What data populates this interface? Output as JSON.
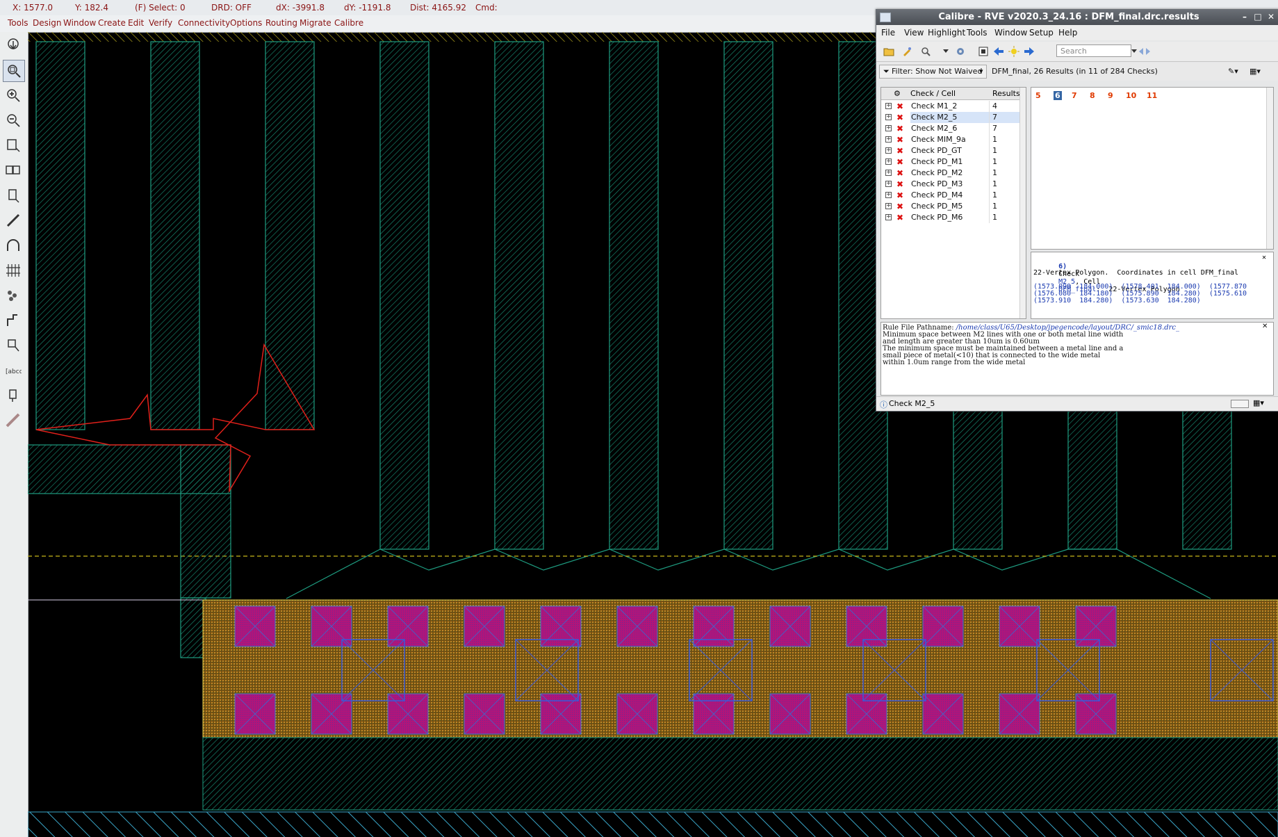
{
  "status": {
    "x": "X: 1577.0",
    "y": "Y: 182.4",
    "select": "(F) Select: 0",
    "drd": "DRD: OFF",
    "dx": "dX: -3991.8",
    "dy": "dY: -1191.8",
    "dist": "Dist: 4165.92",
    "cmd": "Cmd:"
  },
  "main_menu": [
    "Tools",
    "Design",
    "Window",
    "Create",
    "Edit",
    "Verify",
    "Connectivity",
    "Options",
    "Routing",
    "Migrate",
    "Calibre"
  ],
  "left_toolbar": [
    "select-tool-icon",
    "zoom-fit-icon",
    "zoom-in-icon",
    "zoom-out-icon",
    "rectangle-tool-icon",
    "polygon-tool-icon",
    "path-tool-icon",
    "ruler-tool-icon",
    "arc-tool-icon",
    "array-tool-icon",
    "via-tool-icon",
    "route-tool-icon",
    "corner-tool-icon",
    "label-tool-icon",
    "pin-tool-icon",
    "measure-tool-icon"
  ],
  "rve": {
    "title": "Calibre - RVE v2020.3_24.16 : DFM_final.drc.results",
    "menu": [
      "File",
      "View",
      "Highlight",
      "Tools",
      "Window",
      "Setup",
      "Help"
    ],
    "search_placeholder": "Search",
    "filter_label": "Filter: Show Not Waived",
    "summary": "DFM_final, 26 Results (in 11 of 284 Checks)",
    "checks_header": {
      "name": "Check / Cell",
      "count": "Results"
    },
    "checks": [
      {
        "name": "Check M1_2",
        "count": "4"
      },
      {
        "name": "Check M2_5",
        "count": "7",
        "selected": true
      },
      {
        "name": "Check M2_6",
        "count": "7"
      },
      {
        "name": "Check MIM_9a",
        "count": "1"
      },
      {
        "name": "Check PD_GT",
        "count": "1"
      },
      {
        "name": "Check PD_M1",
        "count": "1"
      },
      {
        "name": "Check PD_M2",
        "count": "1"
      },
      {
        "name": "Check PD_M3",
        "count": "1"
      },
      {
        "name": "Check PD_M4",
        "count": "1"
      },
      {
        "name": "Check PD_M5",
        "count": "1"
      },
      {
        "name": "Check PD_M6",
        "count": "1"
      }
    ],
    "result_numbers": [
      "5",
      "6",
      "7",
      "8",
      "9",
      "10",
      "11"
    ],
    "selected_result": "6",
    "detail": {
      "header_prefix": "6)",
      "header_check": "Check",
      "check_name": "M2_5",
      "cell_label": ", Cell",
      "cell_name": "DFM_final",
      "header_suffix": ":  22-Vertex Polygon",
      "subtitle": "22-Vertex Polygon.  Coordinates in cell DFM_final",
      "coords": [
        "(1573.099  184.000)  (1578.401  184.000)  (1577.870",
        "(1576.080  184.180)  (1575.890  184.280)  (1575.610",
        "(1573.910  184.280)  (1573.630  184.280)"
      ]
    },
    "rule": {
      "path_label": "Rule File Pathname:",
      "path": "/home/class/U65/Desktop/jpegencode/layout/DRC/_smic18.drc_",
      "lines": [
        "Minimum space between M2 lines with one or both metal line width",
        "and length are greater than 10um is 0.60um",
        "The minimum space must be maintained between a metal line and a",
        "small piece of metal(<10) that is connected to the wide metal",
        "within 1.0um range from the wide metal"
      ]
    },
    "status_text": "Check M2_5"
  }
}
